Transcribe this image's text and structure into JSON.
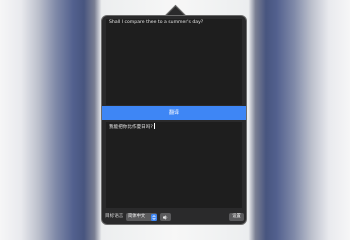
{
  "popover": {
    "source_text": "Shall I compare thee to a summer's day?",
    "translate_label": "翻译",
    "result_text": "我能把你比作夏日吗?"
  },
  "footer": {
    "target_language_label": "目标语言",
    "language_value": "简体中文",
    "settings_label": "设置"
  },
  "icons": {
    "language_arrows": "chevron-up-down-icon",
    "speak": "speaker-icon"
  },
  "colors": {
    "accent": "#3e86f5",
    "panel_background": "#2a2a2b",
    "text_area_background": "#1e1e1e",
    "control_background": "#5a5a5c"
  }
}
